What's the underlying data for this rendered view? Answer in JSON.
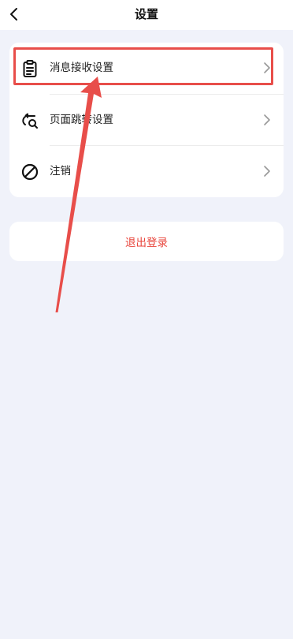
{
  "header": {
    "title": "设置",
    "back_icon": "chevron-left-icon"
  },
  "menu": {
    "items": [
      {
        "label": "消息接收设置",
        "icon": "clipboard-list-icon"
      },
      {
        "label": "页面跳转设置",
        "icon": "redirect-search-icon"
      },
      {
        "label": "注销",
        "icon": "ban-icon"
      }
    ]
  },
  "logout": {
    "label": "退出登录",
    "color": "#e8453c"
  },
  "colors": {
    "background": "#f0f2fa",
    "card": "#ffffff",
    "annotation": "#e84e4a"
  }
}
